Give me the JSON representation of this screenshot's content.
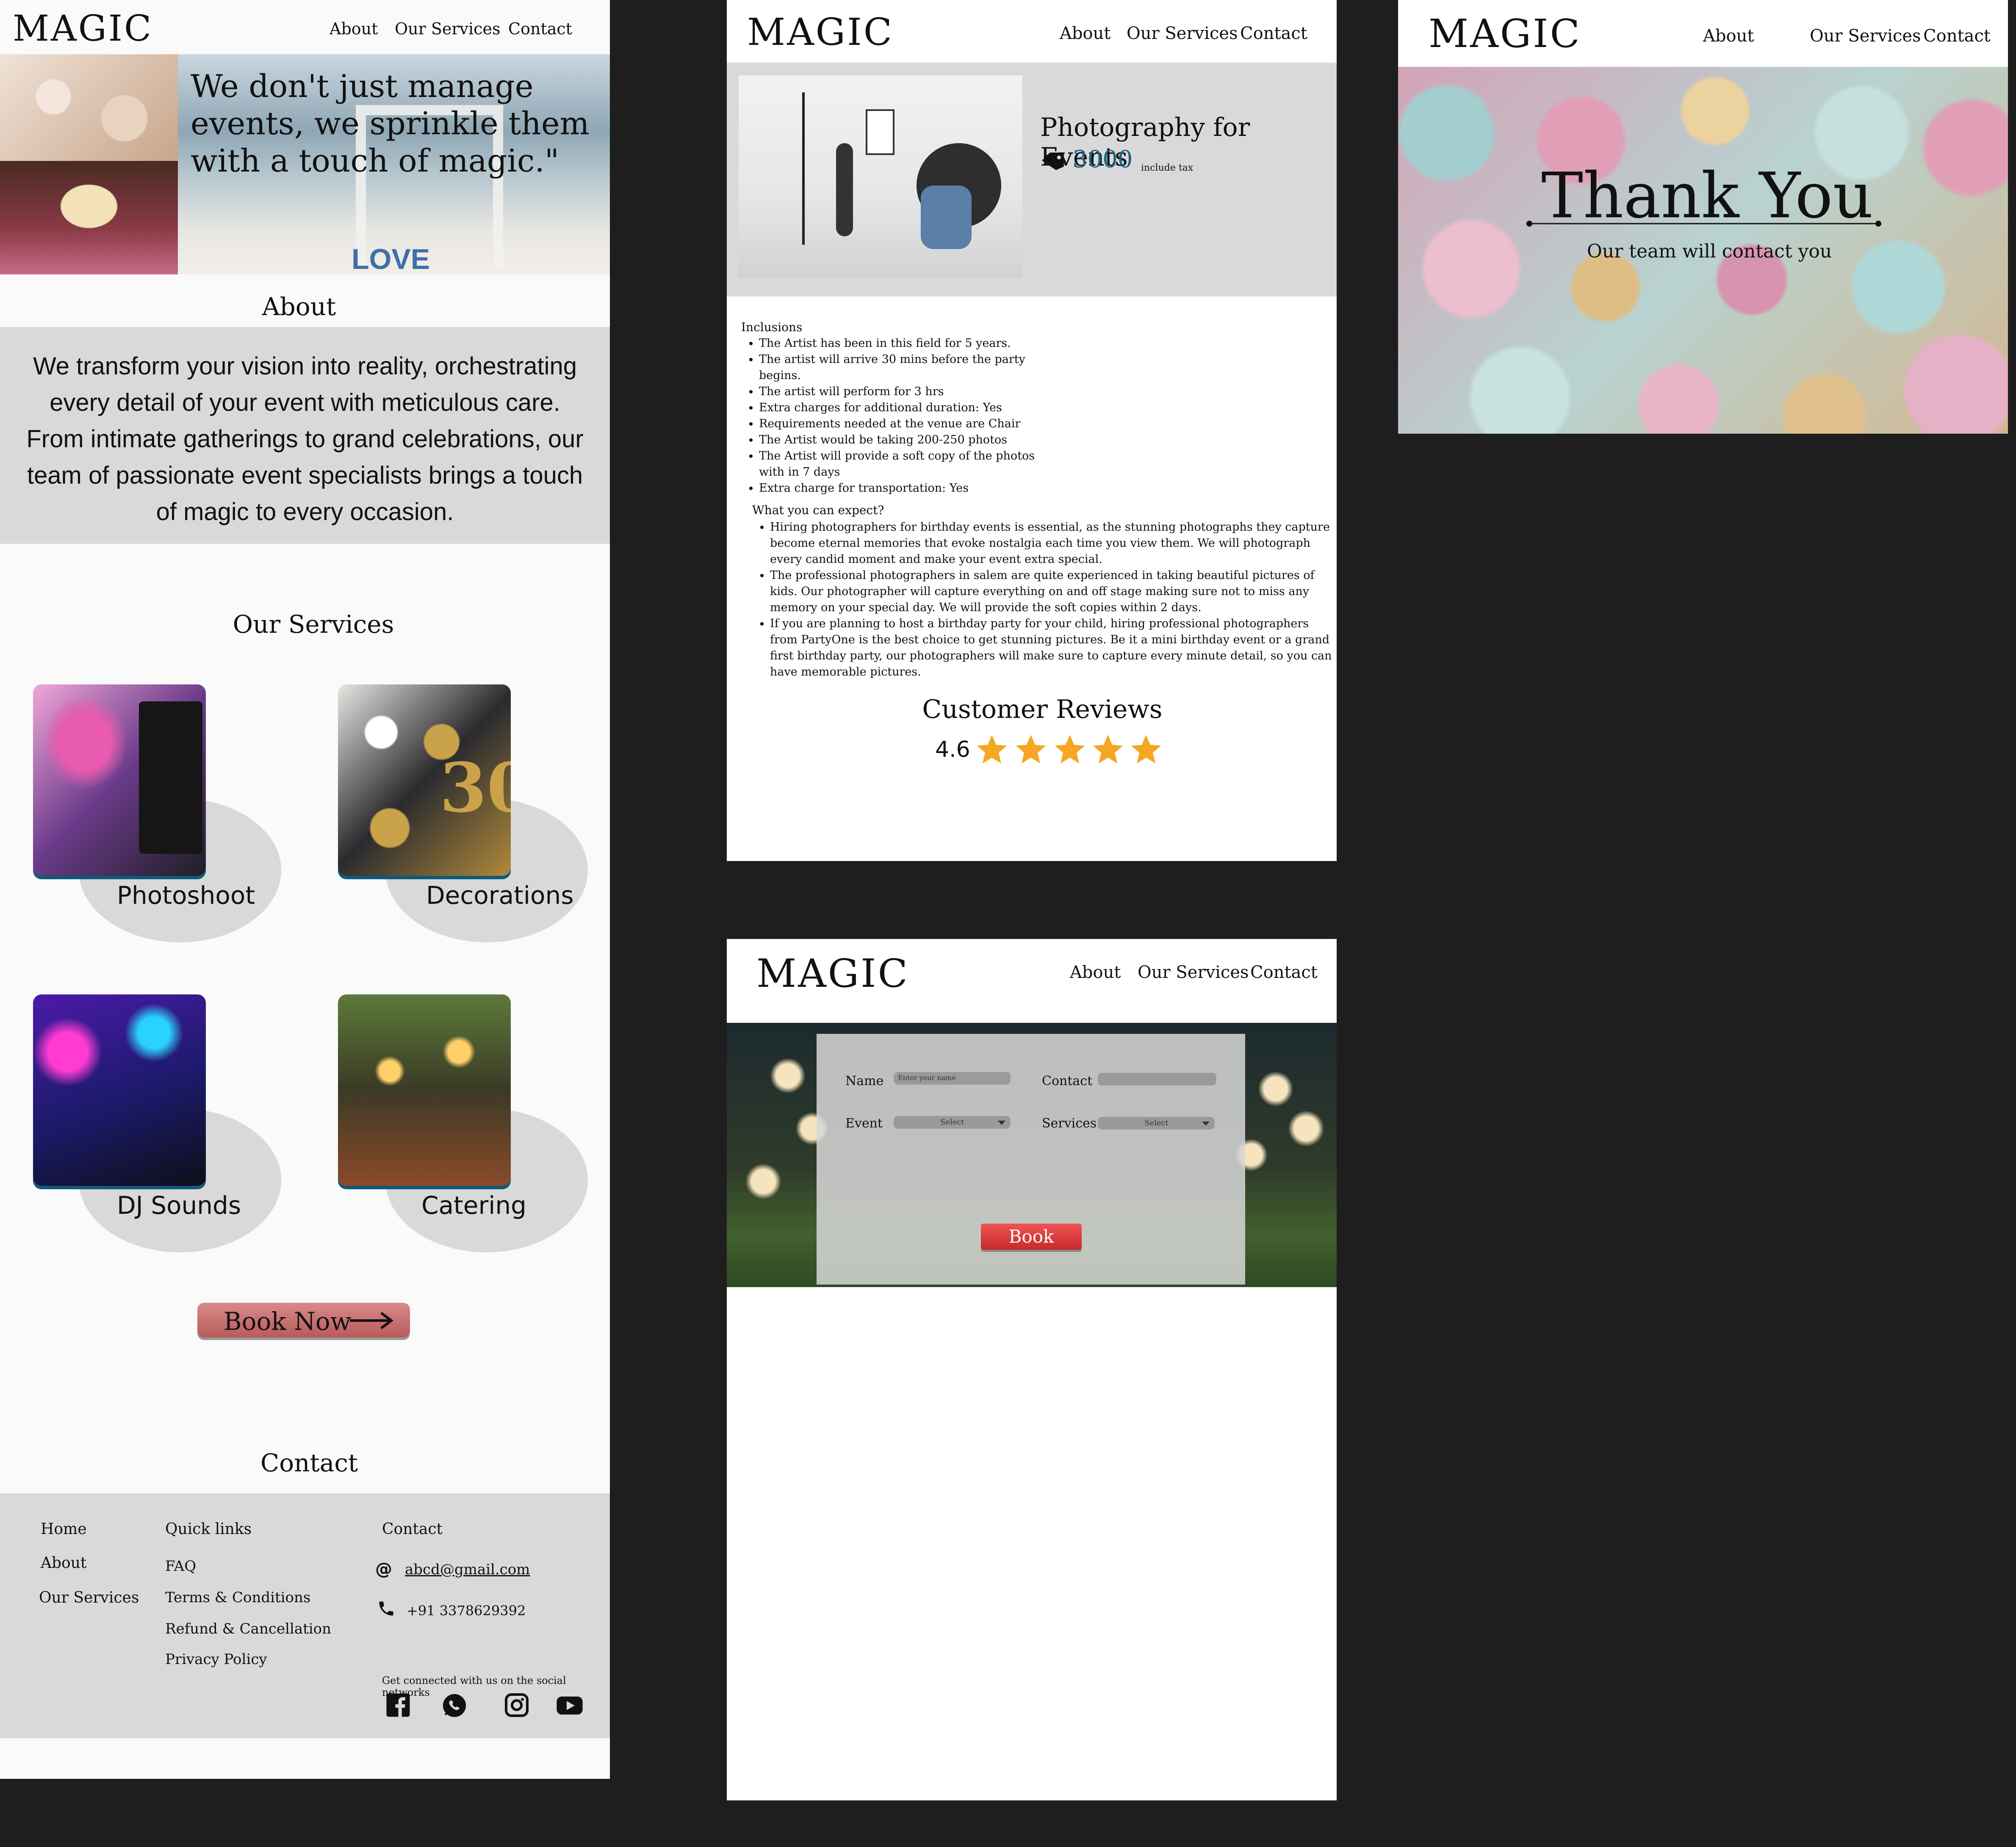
{
  "brand": "MAGIC",
  "nav": {
    "about": "About",
    "services": "Our Services",
    "contact": "Contact"
  },
  "home": {
    "hero_quote": "We don't just manage events, we sprinkle them with a touch of magic.\"",
    "hero_love_text": "LOVE",
    "about_title": "About",
    "about_text": "We transform your vision into reality, orchestrating every detail of your event with meticulous care. From intimate gatherings to grand celebrations, our team of passionate event specialists brings a touch of magic to every occasion.",
    "services_title": "Our Services",
    "services": [
      {
        "label": "Photoshoot"
      },
      {
        "label": "Decorations"
      },
      {
        "label": "DJ Sounds"
      },
      {
        "label": "Catering"
      }
    ],
    "book_now_label": "Book Now",
    "contact_title": "Contact",
    "footer": {
      "col1": [
        "Home",
        "About",
        "Our Services"
      ],
      "quick_links_title": "Quick links",
      "quick_links": [
        "FAQ",
        "Terms & Conditions",
        "Refund & Cancellation",
        "Privacy Policy"
      ],
      "contact_title": "Contact",
      "email": "abcd@gmail.com",
      "phone": "+91 3378629392",
      "social_text": "Get connected with us on the social networks",
      "social_icons": [
        "facebook-icon",
        "whatsapp-icon",
        "instagram-icon",
        "youtube-icon"
      ]
    }
  },
  "detail": {
    "title": "Photography for Events",
    "price": "3000",
    "price_note": "include tax",
    "inclusions_title": "Inclusions",
    "inclusions": [
      "The Artist has been in this field for 5 years.",
      "The artist will arrive 30 mins before the party begins.",
      "The artist will perform for 3 hrs",
      "Extra charges for additional duration: Yes",
      "Requirements needed at the venue are Chair",
      "The Artist would be taking 200-250 photos",
      "The Artist will provide a soft copy of the photos with in 7 days",
      "Extra charge for transportation: Yes"
    ],
    "expect_title": "What you can expect?",
    "expect": [
      "Hiring photographers for birthday events is essential, as the stunning photographs they capture become eternal memories that evoke nostalgia each time you view them. We will photograph every candid moment and make your event extra special.",
      "The professional photographers in salem are quite experienced in taking beautiful pictures of kids. Our photographer will capture everything on and off stage making sure not to miss any memory on your special day. We will provide the soft copies within 2 days.",
      "If you are planning to host a birthday party for your child, hiring professional photographers from PartyOne is the best choice to get stunning pictures. Be it a mini birthday event or a grand first birthday party, our photographers will make sure to capture every minute detail, so you can have memorable pictures."
    ],
    "reviews_title": "Customer Reviews",
    "rating": "4.6",
    "rating_value": 4.6,
    "star_color": "#f5a623"
  },
  "thankyou": {
    "title": "Thank You",
    "subtitle": "Our team will contact you"
  },
  "booking": {
    "name_label": "Name",
    "name_placeholder": "Enter your name",
    "contact_label": "Contact",
    "event_label": "Event",
    "event_value": "Select",
    "services_label": "Services",
    "services_value": "Select",
    "book_label": "Book"
  },
  "colors": {
    "canvas": "#1e1e1e",
    "panel_gray": "#d9d9d9",
    "book_now": "#c96a6a",
    "book_button": "#e03c3c",
    "price_blue": "#1d5f86"
  }
}
